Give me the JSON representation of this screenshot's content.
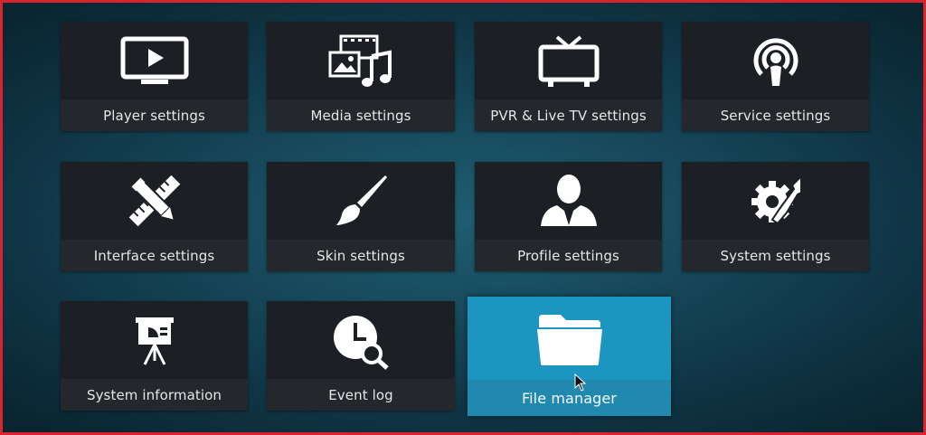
{
  "colors": {
    "border": "#d9232e",
    "tile": "#1c1f24",
    "label_bar": "#24282d",
    "focus": "#1c95c0",
    "icon": "#ffffff"
  },
  "tiles": [
    {
      "label": "Player settings",
      "icon": "tv-play-icon"
    },
    {
      "label": "Media settings",
      "icon": "media-film-music-icon"
    },
    {
      "label": "PVR & Live TV settings",
      "icon": "tv-antenna-icon"
    },
    {
      "label": "Service settings",
      "icon": "podcast-broadcast-icon"
    },
    {
      "label": "Interface settings",
      "icon": "pencil-ruler-icon"
    },
    {
      "label": "Skin settings",
      "icon": "paintbrush-icon"
    },
    {
      "label": "Profile settings",
      "icon": "user-silhouette-icon"
    },
    {
      "label": "System settings",
      "icon": "gear-wrench-icon"
    },
    {
      "label": "System information",
      "icon": "presentation-board-icon"
    },
    {
      "label": "Event log",
      "icon": "clock-search-icon"
    },
    {
      "label": "File manager",
      "icon": "folder-icon",
      "focused": true
    }
  ]
}
